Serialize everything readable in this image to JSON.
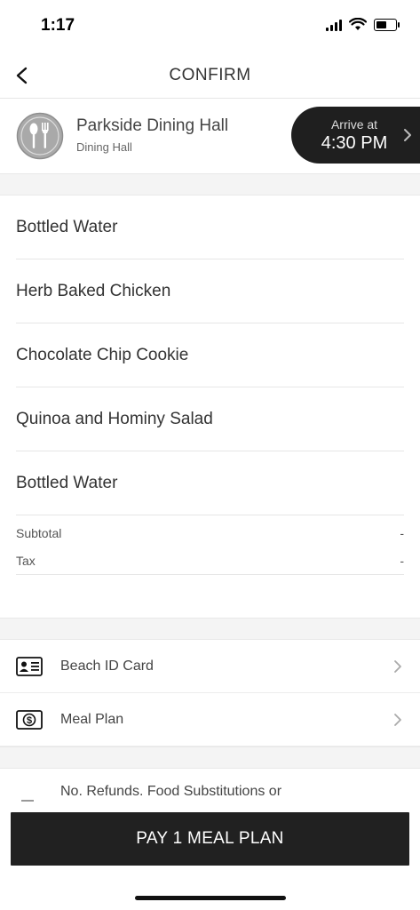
{
  "status_bar": {
    "time": "1:17",
    "battery_level": 0.45
  },
  "nav": {
    "title": "CONFIRM",
    "back_icon": "chevron-left-icon"
  },
  "location": {
    "name": "Parkside Dining Hall",
    "type": "Dining Hall",
    "icon": "utensils-icon",
    "arrive_label": "Arrive at",
    "arrive_time": "4:30 PM"
  },
  "order": {
    "items": [
      {
        "label": "Bottled Water"
      },
      {
        "label": "Herb Baked Chicken"
      },
      {
        "label": "Chocolate Chip Cookie"
      },
      {
        "label": "Quinoa and Hominy Salad"
      },
      {
        "label": "Bottled Water"
      }
    ],
    "subtotal_label": "Subtotal",
    "subtotal_value": "-",
    "tax_label": "Tax",
    "tax_value": "-"
  },
  "payment": {
    "methods": [
      {
        "label": "Beach ID Card",
        "icon": "id-card-icon"
      },
      {
        "label": "Meal Plan",
        "icon": "dollar-icon"
      }
    ]
  },
  "disclaimer": {
    "text": "No. Refunds. Food Substitutions or"
  },
  "pay_button": {
    "label": "PAY 1 MEAL PLAN"
  },
  "colors": {
    "dark": "#1f1f1f",
    "divider": "#e6e6e6",
    "band": "#f4f4f4"
  }
}
